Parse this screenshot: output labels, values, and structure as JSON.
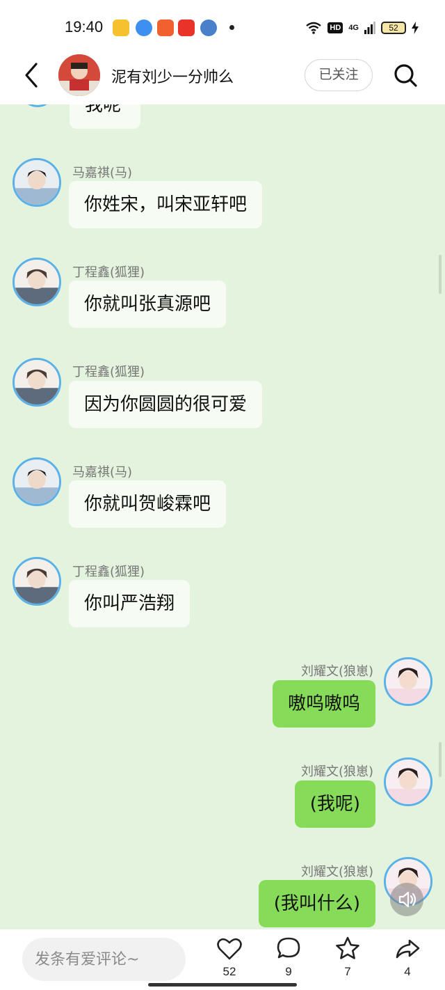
{
  "status_bar": {
    "time": "19:40",
    "hd": "HD",
    "network": "4G",
    "battery": "52"
  },
  "header": {
    "title": "泥有刘少一分帅么",
    "follow_label": "已关注"
  },
  "chat": {
    "partial_top_text": "我呢",
    "messages": [
      {
        "sender": "马嘉祺(马)",
        "text": "你姓宋，叫宋亚轩吧",
        "side": "left"
      },
      {
        "sender": "丁程鑫(狐狸)",
        "text": "你就叫张真源吧",
        "side": "left"
      },
      {
        "sender": "丁程鑫(狐狸)",
        "text": "因为你圆圆的很可爱",
        "side": "left"
      },
      {
        "sender": "马嘉祺(马)",
        "text": "你就叫贺峻霖吧",
        "side": "left"
      },
      {
        "sender": "丁程鑫(狐狸)",
        "text": "你叫严浩翔",
        "side": "left"
      },
      {
        "sender": "刘耀文(狼崽)",
        "text": "嗷呜嗷呜",
        "side": "right"
      },
      {
        "sender": "刘耀文(狼崽)",
        "text": "(我呢)",
        "side": "right"
      },
      {
        "sender": "刘耀文(狼崽)",
        "text": "(我叫什么)",
        "side": "right"
      }
    ]
  },
  "bottom_bar": {
    "comment_placeholder": "发条有爱评论~",
    "like_count": "52",
    "comment_count": "9",
    "favorite_count": "7",
    "share_count": "4"
  },
  "colors": {
    "chat_background": "#e4f3dd",
    "left_bubble": "#f6fbf3",
    "right_bubble": "#86dc58",
    "avatar_ring": "#5ab1e8"
  }
}
